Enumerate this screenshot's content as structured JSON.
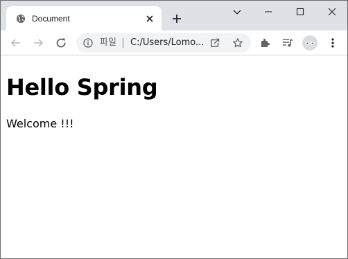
{
  "tab": {
    "title": "Document"
  },
  "toolbar": {
    "scheme_label": "파일",
    "url": "C:/Users/Lomo..."
  },
  "page": {
    "heading": "Hello Spring",
    "paragraph": "Welcome !!!"
  },
  "colors": {
    "tabstrip_bg": "#dee1e6",
    "omnibox_bg": "#f1f3f4",
    "icon_gray": "#5f6368",
    "disabled_gray": "#bdc1c6"
  },
  "icons": {
    "favicon": "globe-icon",
    "tab_close": "close-icon",
    "new_tab": "plus-icon",
    "tab_search": "chevron-down-icon",
    "minimize": "minimize-icon",
    "maximize": "maximize-icon",
    "close_window": "close-icon",
    "back": "arrow-left-icon",
    "forward": "arrow-right-icon",
    "reload": "reload-icon",
    "site_info": "info-icon",
    "share": "share-icon",
    "bookmark": "star-icon",
    "extensions": "puzzle-icon",
    "media": "media-queue-icon",
    "profile": "avatar-icon",
    "menu": "kebab-menu-icon"
  }
}
